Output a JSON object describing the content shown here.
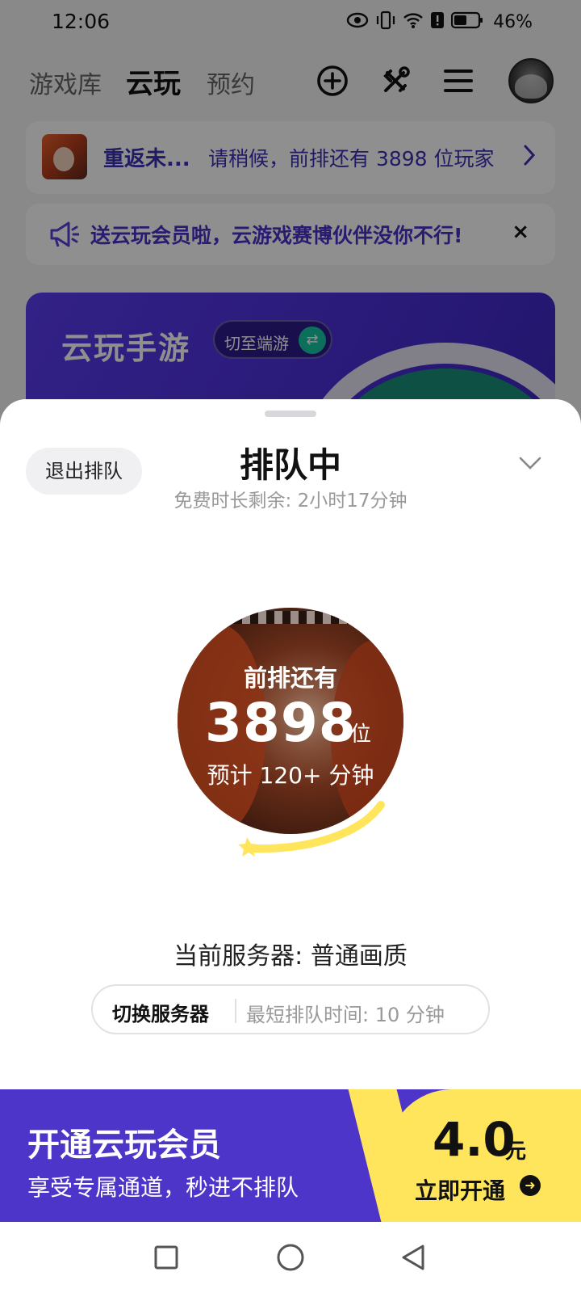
{
  "status_bar": {
    "time": "12:06",
    "battery": "46%"
  },
  "top_nav": {
    "tabs": [
      "游戏库",
      "云玩",
      "预约"
    ],
    "active_tab": "云玩",
    "icons": [
      "add-circle-icon",
      "tools-icon",
      "menu-icon"
    ]
  },
  "queue_card": {
    "game_name": "重返未...",
    "status": "请稍候，前排还有 3898 位玩家"
  },
  "promo": {
    "text": "送云玩会员啦，云游戏赛博伙伴没你不行!",
    "close": "×"
  },
  "banner": {
    "title": "云玩手游",
    "switch_label": "切至端游",
    "switch_icon": "⇄"
  },
  "sheet": {
    "exit_button": "退出排队",
    "title": "排队中",
    "subtitle": "免费时长剩余: 2小时17分钟",
    "queue": {
      "label": "前排还有",
      "count": "3898",
      "unit": "位",
      "estimate": "预计 120+ 分钟"
    },
    "server": {
      "current": "当前服务器:  普通画质",
      "switch_label": "切换服务器",
      "min_wait": "最短排队时间:  10 分钟"
    }
  },
  "membership": {
    "title": "开通云玩会员",
    "subtitle": "享受专属通道，秒进不排队",
    "price": "4.0",
    "price_unit": "元",
    "cta": "立即开通",
    "cta_icon": "➜"
  },
  "colors": {
    "accent_purple": "#4d35c9",
    "accent_yellow": "#ffe55c",
    "accent_teal": "#17c6a3",
    "queue_text": "#3b2fb4"
  }
}
